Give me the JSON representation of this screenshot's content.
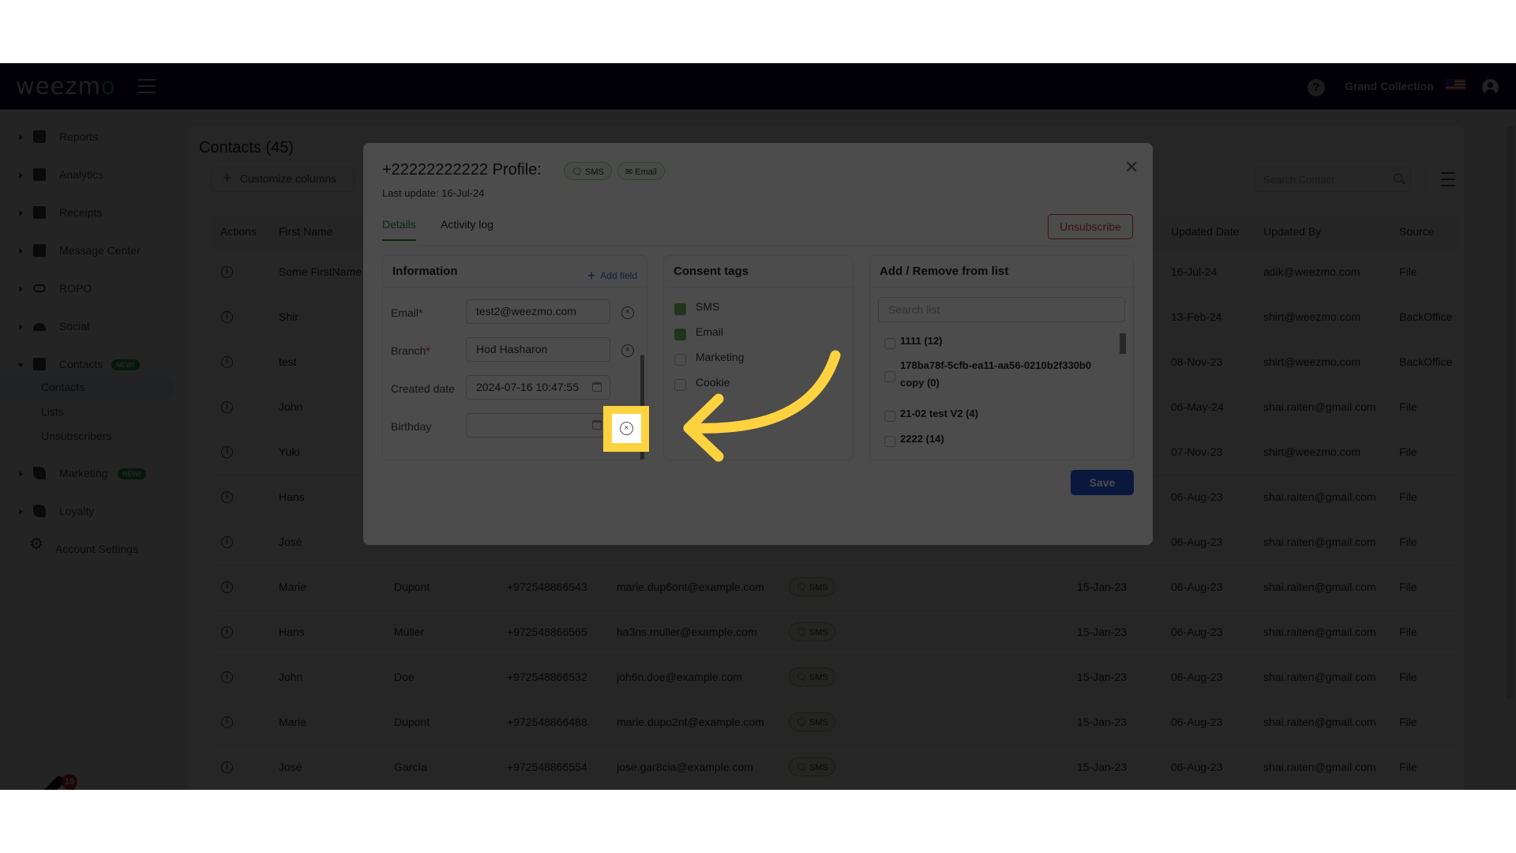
{
  "app": {
    "logo": "weezm",
    "logo_accent": "o",
    "account_name": "Grand Collection",
    "help_label": "?"
  },
  "sidebar": {
    "items": [
      {
        "label": "Reports",
        "icon": "dashboard-icon"
      },
      {
        "label": "Analytics",
        "icon": "analytics-icon"
      },
      {
        "label": "Receipts",
        "icon": "receipt-icon"
      },
      {
        "label": "Message Center",
        "icon": "chat-icon"
      },
      {
        "label": "ROPO",
        "icon": "infinity-icon"
      },
      {
        "label": "Social",
        "icon": "people-icon"
      },
      {
        "label": "Contacts",
        "icon": "contact-icon",
        "badge": "NEW!",
        "expanded": true
      },
      {
        "label": "Marketing",
        "icon": "megaphone-icon",
        "badge": "NEW!"
      },
      {
        "label": "Loyalty",
        "icon": "tag-icon"
      }
    ],
    "contacts_sub": [
      "Contacts",
      "Lists",
      "Unsubscribers"
    ],
    "selected_sub": "Contacts",
    "account_settings": "Account Settings",
    "notification_count": "19"
  },
  "page": {
    "title": "Contacts (45)",
    "customize_columns": "Customize columns",
    "search_placeholder": "Search Contact",
    "columns": [
      "Actions",
      "First Name",
      "Updated Date",
      "Updated By",
      "Source"
    ],
    "rows_top": [
      {
        "first": "Some FirstName",
        "updated": "16-Jul-24",
        "by": "adik@weezmo.com",
        "source": "File"
      },
      {
        "first": "Shir",
        "updated": "13-Feb-24",
        "by": "shirt@weezmo.com",
        "source": "BackOffice"
      },
      {
        "first": "test",
        "updated": "08-Nov-23",
        "by": "shirt@weezmo.com",
        "source": "BackOffice"
      },
      {
        "first": "John",
        "updated": "06-May-24",
        "by": "shai.raiten@gmail.com",
        "source": "File"
      },
      {
        "first": "Yuki",
        "updated": "07-Nov-23",
        "by": "shirt@weezmo.com",
        "source": "File"
      },
      {
        "first": "Hans",
        "updated": "06-Aug-23",
        "by": "shai.raiten@gmail.com",
        "source": "File"
      },
      {
        "first": "José",
        "updated": "06-Aug-23",
        "by": "shai.raiten@gmail.com",
        "source": "File"
      }
    ],
    "rows_bottom": [
      {
        "first": "Marie",
        "last": "Dupont",
        "phone": "+972548866543",
        "email": "marie.dup6ont@example.com",
        "tag": "SMS",
        "created": "15-Jan-23",
        "updated": "06-Aug-23",
        "by": "shai.raiten@gmail.com",
        "source": "File"
      },
      {
        "first": "Hans",
        "last": "Müller",
        "phone": "+972548866565",
        "email": "ha3ns.muller@example.com",
        "tag": "SMS",
        "created": "15-Jan-23",
        "updated": "06-Aug-23",
        "by": "shai.raiten@gmail.com",
        "source": "File"
      },
      {
        "first": "John",
        "last": "Doe",
        "phone": "+972548866532",
        "email": "joh6n.doe@example.com",
        "tag": "SMS",
        "created": "15-Jan-23",
        "updated": "06-Aug-23",
        "by": "shai.raiten@gmail.com",
        "source": "File"
      },
      {
        "first": "Marie",
        "last": "Dupont",
        "phone": "+972548866488",
        "email": "marie.dupo2nt@example.com",
        "tag": "SMS",
        "created": "15-Jan-23",
        "updated": "06-Aug-23",
        "by": "shai.raiten@gmail.com",
        "source": "File"
      },
      {
        "first": "José",
        "last": "García",
        "phone": "+972548866554",
        "email": "jose.gar8cia@example.com",
        "tag": "SMS",
        "created": "15-Jan-23",
        "updated": "06-Aug-23",
        "by": "shai.raiten@gmail.com",
        "source": "File"
      }
    ]
  },
  "modal": {
    "title": "+22222222222 Profile:",
    "tags": [
      "SMS",
      "Email"
    ],
    "last_update": "Last update: 16-Jul-24",
    "tabs": [
      "Details",
      "Activity log"
    ],
    "active_tab": "Details",
    "unsubscribe": "Unsubscribe",
    "save": "Save",
    "information": {
      "title": "Information",
      "add_field": "Add field",
      "fields": [
        {
          "label": "Email",
          "required": true,
          "value": "test2@weezmo.com"
        },
        {
          "label": "Branch",
          "required": true,
          "value": "Hod Hasharon"
        },
        {
          "label": "Created date",
          "required": false,
          "value": "2024-07-16 10:47:55"
        },
        {
          "label": "Birthday",
          "required": false,
          "value": ""
        }
      ]
    },
    "consent": {
      "title": "Consent tags",
      "items": [
        {
          "label": "SMS",
          "checked": true
        },
        {
          "label": "Email",
          "checked": true
        },
        {
          "label": "Marketing",
          "checked": false
        },
        {
          "label": "Cookie",
          "checked": false
        }
      ]
    },
    "lists": {
      "title": "Add / Remove from list",
      "search_placeholder": "Search list",
      "items": [
        "1111 (12)",
        "178ba78f-5cfb-ea11-aa56-0210b2f330b0 copy (0)",
        "21-02 test V2 (4)",
        "2222 (14)"
      ]
    }
  },
  "annotation": {
    "highlight_target": "birthday-clear-button",
    "highlight_color": "#ffd23f"
  }
}
